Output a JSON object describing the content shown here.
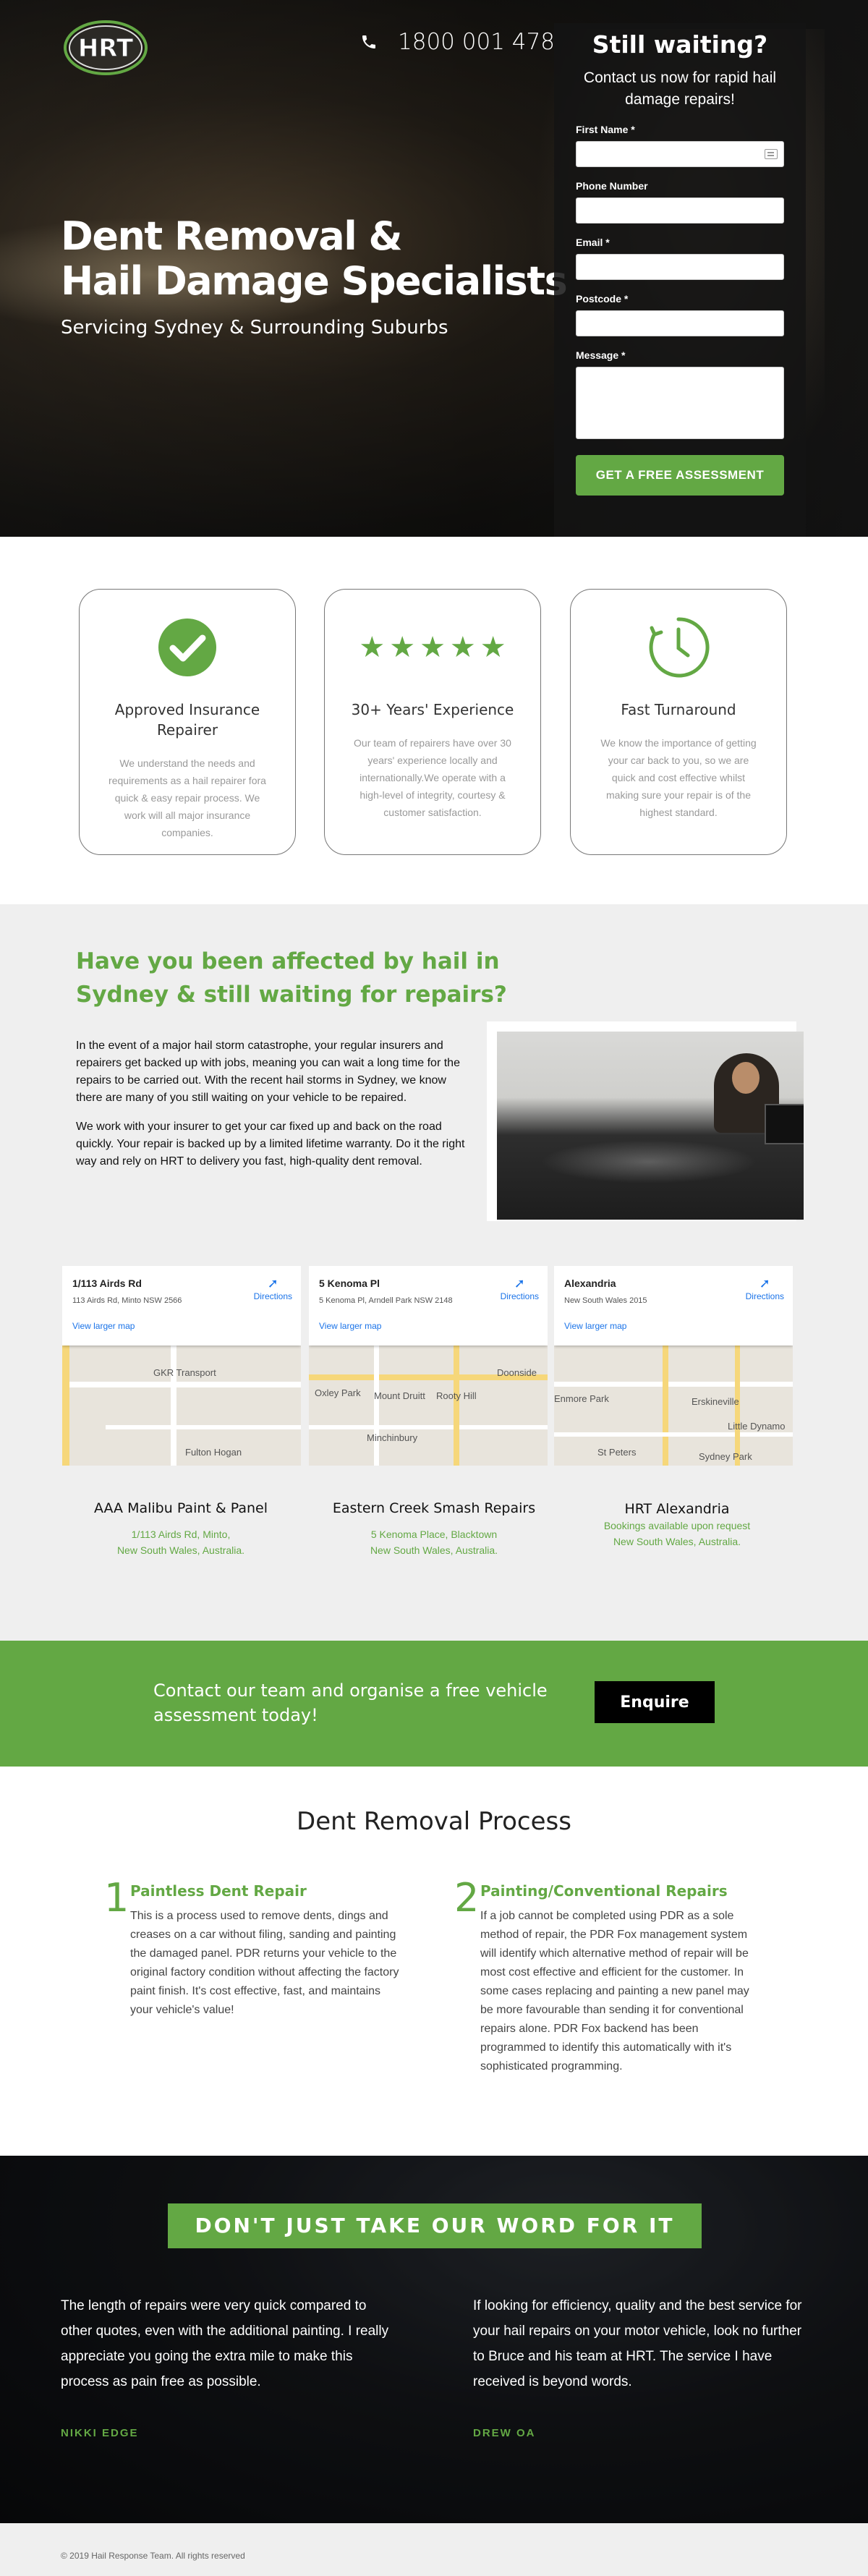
{
  "header": {
    "logo_text": "HRT",
    "phone": "1800 001 478",
    "title_line1": "Dent Removal &",
    "title_line2": "Hail Damage Specialists",
    "subtitle": "Servicing Sydney & Surrounding Suburbs"
  },
  "form": {
    "title": "Still waiting?",
    "subtitle": "Contact us now for rapid hail damage repairs!",
    "fields": {
      "first_name": "First Name *",
      "phone": "Phone Number",
      "email": "Email *",
      "postcode": "Postcode *",
      "message": "Message *"
    },
    "submit": "GET A FREE ASSESSMENT"
  },
  "features": [
    {
      "title": "Approved Insurance Repairer",
      "text": "We understand the needs and requirements as a hail repairer fora quick & easy repair process. We work will all major insurance companies.",
      "icon": "check-circle-icon"
    },
    {
      "title": "30+ Years' Experience",
      "text": "Our team of repairers have over 30 years' experience locally and internationally.We operate with a high-level of integrity, courtesy & customer satisfaction.",
      "icon": "five-stars-icon"
    },
    {
      "title": "Fast Turnaround",
      "text": "We know the importance of getting your car back to you, so we are quick and cost effective whilst making sure your repair is of the highest standard.",
      "icon": "clock-icon"
    }
  ],
  "hail": {
    "heading": "Have you been affected by hail in Sydney & still waiting for repairs?",
    "para1": "In the event of a major hail storm catastrophe, your regular insurers and repairers get backed up with jobs, meaning you can wait a long time for the repairs to be carried out. With the recent hail storms in Sydney, we know there are many of you still waiting on your vehicle to be repaired.",
    "para2": "We work with your insurer to get your car fixed up and back on the road quickly. Your repair is backed up by a limited lifetime warranty. Do it the right way and rely on HRT to delivery you fast, high-quality dent removal."
  },
  "maps": [
    {
      "title": "1/113 Airds Rd",
      "address": "113 Airds Rd, Minto NSW 2566",
      "directions": "Directions",
      "link": "View larger map",
      "labels": [
        "GKR Transport",
        "Fulton Hogan"
      ]
    },
    {
      "title": "5 Kenoma Pl",
      "address": "5 Kenoma Pl, Arndell Park NSW 2148",
      "directions": "Directions",
      "link": "View larger map",
      "labels": [
        "Oxley Park",
        "Mount Druitt",
        "Rooty Hill",
        "Minchinbury",
        "Doonside"
      ]
    },
    {
      "title": "Alexandria",
      "address": "New South Wales 2015",
      "directions": "Directions",
      "link": "View larger map",
      "labels": [
        "Enmore Park",
        "Erskineville",
        "St Peters",
        "Sydney Park",
        "Little Dynamo"
      ]
    }
  ],
  "locations": [
    {
      "name": "AAA Malibu Paint & Panel",
      "line1": "1/113 Airds Rd, Minto,",
      "line2": "New South Wales, Australia."
    },
    {
      "name": "Eastern Creek Smash Repairs",
      "line1": "5 Kenoma Place, Blacktown",
      "line2": "New South Wales, Australia."
    },
    {
      "name": "HRT Alexandria",
      "line1": "Bookings available upon request",
      "line2": "New South Wales, Australia."
    }
  ],
  "cta": {
    "text": "Contact our team and organise a free vehicle assessment today!",
    "button": "Enquire"
  },
  "process": {
    "heading": "Dent Removal Process",
    "steps": [
      {
        "num": "1",
        "title": "Paintless Dent Repair",
        "text": "This is a process used to remove dents, dings and creases on a car without filing, sanding and painting the damaged panel. PDR returns your vehicle to the original factory condition without affecting the factory paint finish. It's cost effective, fast, and maintains your vehicle's value!"
      },
      {
        "num": "2",
        "title": "Painting/Conventional Repairs",
        "text": "If a job cannot be completed using PDR as a sole method of repair, the PDR Fox management system will identify which alternative method of repair will be most cost effective and efficient for the customer.  In some cases replacing and painting a new panel may be more favourable than sending it for conventional repairs alone. PDR Fox backend has been programmed to identify this automatically with it's sophisticated programming."
      }
    ]
  },
  "testimonials": {
    "banner": "DON'T JUST TAKE OUR WORD FOR IT",
    "items": [
      {
        "quote": "The length of repairs were very quick compared to other quotes, even with the additional painting. I really appreciate you going the extra mile to make this process as pain free as possible.",
        "author": "NIKKI EDGE"
      },
      {
        "quote": "If looking for efficiency, quality and the best service for your hail repairs on your motor vehicle, look no further to Bruce and his team at HRT. The service I have received is beyond words.",
        "author": "DREW OA"
      }
    ]
  },
  "footer": {
    "copyright": "© 2019 Hail Response Team. All rights reserved"
  },
  "colors": {
    "brand_green": "#63a844",
    "dark": "#141414"
  }
}
